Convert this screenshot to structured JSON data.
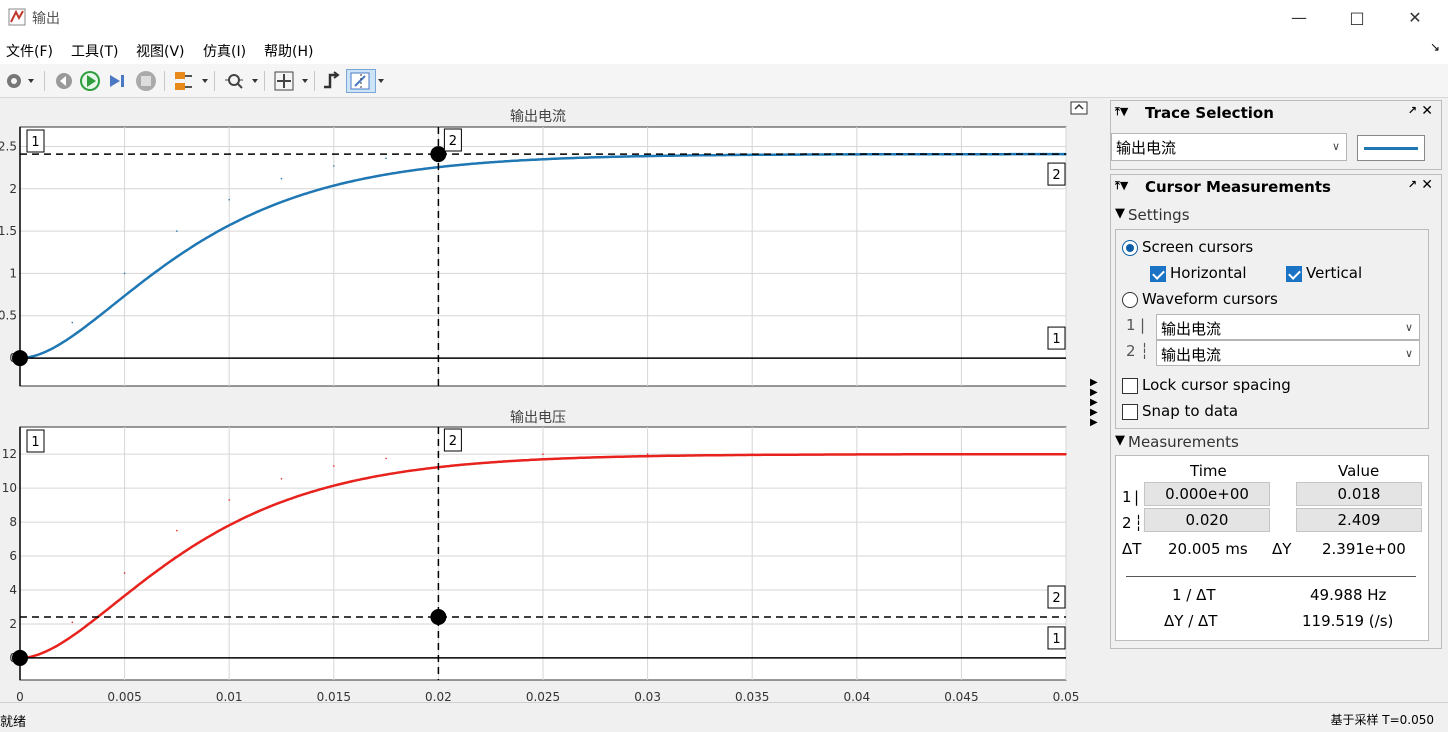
{
  "window": {
    "title": "输出"
  },
  "menu": [
    {
      "label": "文件(F)"
    },
    {
      "label": "工具(T)"
    },
    {
      "label": "视图(V)"
    },
    {
      "label": "仿真(I)"
    },
    {
      "label": "帮助(H)"
    }
  ],
  "plots": [
    {
      "title": "输出电流",
      "color": "#1f77b4",
      "yticks": [
        "2.5",
        "2",
        "1.5",
        "1",
        "0.5",
        "0"
      ],
      "ytick_values": [
        2.5,
        2,
        1.5,
        1,
        0.5,
        0
      ],
      "ylim": [
        -0.33,
        2.73
      ],
      "final": 2.41,
      "cursor_h1": 0.0,
      "cursor_h2": 2.41
    },
    {
      "title": "输出电压",
      "color": "#e8221c",
      "yticks": [
        "12",
        "10",
        "8",
        "6",
        "4",
        "2",
        "0"
      ],
      "ytick_values": [
        12,
        10,
        8,
        6,
        4,
        2,
        0
      ],
      "ylim": [
        -1.3,
        13.6
      ],
      "final": 12.0,
      "cursor_h1": 0.0,
      "cursor_h2": 2.41
    }
  ],
  "xaxis": {
    "ticks": [
      "0",
      "0.005",
      "0.01",
      "0.015",
      "0.02",
      "0.025",
      "0.03",
      "0.035",
      "0.04",
      "0.045",
      "0.05"
    ],
    "tick_values": [
      0,
      0.005,
      0.01,
      0.015,
      0.02,
      0.025,
      0.03,
      0.035,
      0.04,
      0.045,
      0.05
    ],
    "xlim": [
      0,
      0.05
    ]
  },
  "cursors": {
    "v1": 0.0,
    "v2": 0.02,
    "label1": "1",
    "label2": "2"
  },
  "chart_data": [
    {
      "type": "line",
      "title": "输出电流",
      "x": [
        0,
        0.0025,
        0.005,
        0.0075,
        0.01,
        0.0125,
        0.015,
        0.0175,
        0.02,
        0.025,
        0.03,
        0.035,
        0.04,
        0.045,
        0.05
      ],
      "series": [
        {
          "values": [
            0,
            0.42,
            1.0,
            1.5,
            1.87,
            2.12,
            2.27,
            2.36,
            2.4,
            2.41,
            2.41,
            2.41,
            2.41,
            2.41,
            2.41
          ]
        }
      ],
      "xlim": [
        0,
        0.05
      ],
      "ylim": [
        0,
        2.5
      ]
    },
    {
      "type": "line",
      "title": "输出电压",
      "x": [
        0,
        0.0025,
        0.005,
        0.0075,
        0.01,
        0.0125,
        0.015,
        0.0175,
        0.02,
        0.025,
        0.03,
        0.035,
        0.04,
        0.045,
        0.05
      ],
      "series": [
        {
          "values": [
            0,
            2.1,
            5.0,
            7.5,
            9.3,
            10.55,
            11.3,
            11.75,
            11.95,
            12.0,
            12.0,
            12.0,
            12.0,
            12.0,
            12.0
          ]
        }
      ],
      "xlim": [
        0,
        0.05
      ],
      "ylim": [
        0,
        12
      ]
    }
  ],
  "trace_selection": {
    "title": "Trace Selection",
    "signal": "输出电流",
    "line_color": "#1f77b4"
  },
  "cursor_measurements": {
    "title": "Cursor Measurements",
    "settings_label": "Settings",
    "screen_cursors": "Screen cursors",
    "horizontal": "Horizontal",
    "vertical": "Vertical",
    "waveform_cursors": "Waveform cursors",
    "wf1_label": "1",
    "wf2_label": "2",
    "wf1_signal": "输出电流",
    "wf2_signal": "输出电流",
    "lock_spacing": "Lock cursor spacing",
    "snap": "Snap to data",
    "measurements_label": "Measurements",
    "col_time": "Time",
    "col_value": "Value",
    "row1_label": "1",
    "row2_label": "2",
    "t1": "0.000e+00",
    "v1": "0.018",
    "t2": "0.020",
    "v2": "2.409",
    "dT_label": "ΔT",
    "dT": "20.005 ms",
    "dY_label": "ΔY",
    "dY": "2.391e+00",
    "inv_dT_label": "1 / ΔT",
    "inv_dT": "49.988 Hz",
    "dYdT_label": "ΔY / ΔT",
    "dYdT": "119.519 (/s)"
  },
  "status": {
    "ready": "就绪",
    "right": "基于采样  T=0.050"
  }
}
